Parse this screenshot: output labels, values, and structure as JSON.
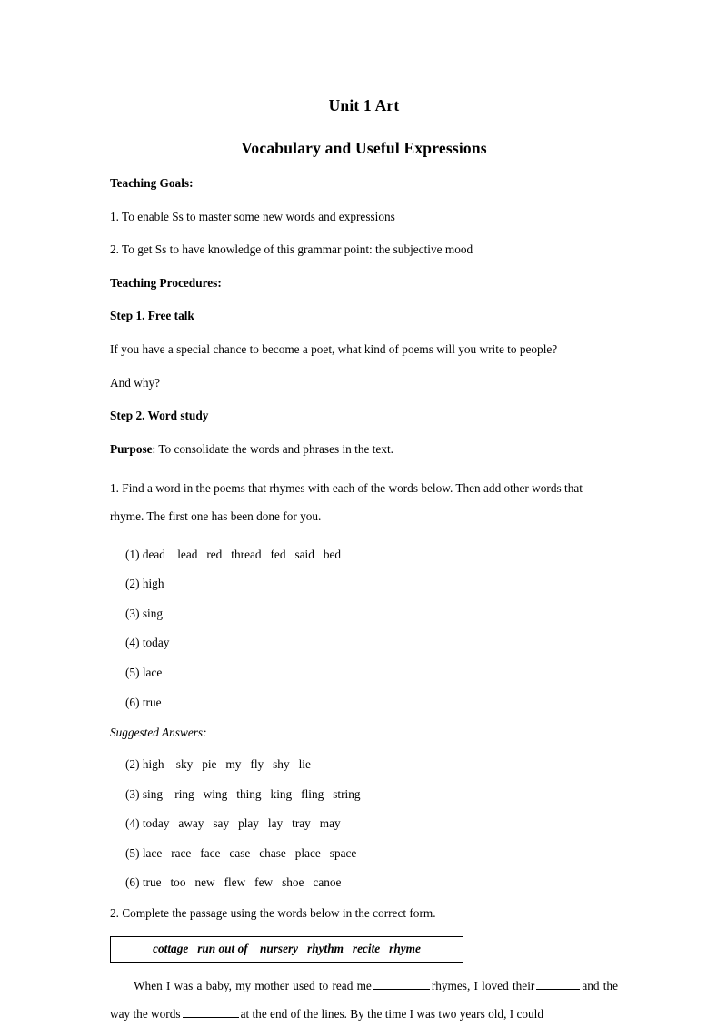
{
  "document": {
    "title": "Unit 1 Art",
    "subtitle": "Vocabulary and Useful Expressions"
  },
  "sections": {
    "teaching_goals_heading": "Teaching Goals:",
    "goal_1": "1. To enable Ss to master some new words and expressions",
    "goal_2": "2. To get Ss to have knowledge of this grammar point: the subjective mood",
    "teaching_procedures_heading": "Teaching Procedures:",
    "step1_heading": "Step 1. Free talk",
    "step1_line1": "If you have a special chance to become a poet, what kind of poems will you write to people?",
    "step1_line2": "And why?",
    "step2_heading": "Step 2. Word study",
    "purpose_label": "Purpose",
    "purpose_text": ": To consolidate the words and phrases in the text.",
    "task1_instruction": "1. Find a word in the poems that rhymes with each of the words below. Then add other words that rhyme. The first one has been done for you.",
    "suggested_answers_label": "Suggested Answers:",
    "task2_instruction": "2. Complete the passage using the words below in the correct form."
  },
  "rhyme_prompts": [
    "(1) dead    lead   red   thread   fed   said   bed",
    "(2) high",
    "(3) sing",
    "(4) today",
    "(5) lace",
    "(6) true"
  ],
  "rhyme_answers": [
    "(2) high    sky   pie   my   fly   shy   lie",
    "(3) sing    ring   wing   thing   king   fling   string",
    "(4) today   away   say   play   lay   tray   may",
    "(5) lace   race   face   case   chase   place   space",
    "(6) true   too   new   flew   few   shoe   canoe"
  ],
  "word_bank": {
    "words_line": "cottage   run out of    nursery   rhythm   recite   rhyme",
    "words": [
      "cottage",
      "run out of",
      "nursery",
      "rhythm",
      "recite",
      "rhyme"
    ]
  },
  "passage": {
    "part1": "When I was a baby, my mother used to read me",
    "part2": "rhymes, I loved their",
    "part3": "and the way the words",
    "part4": "at the end of the lines. By the time I was two years old, I could"
  }
}
